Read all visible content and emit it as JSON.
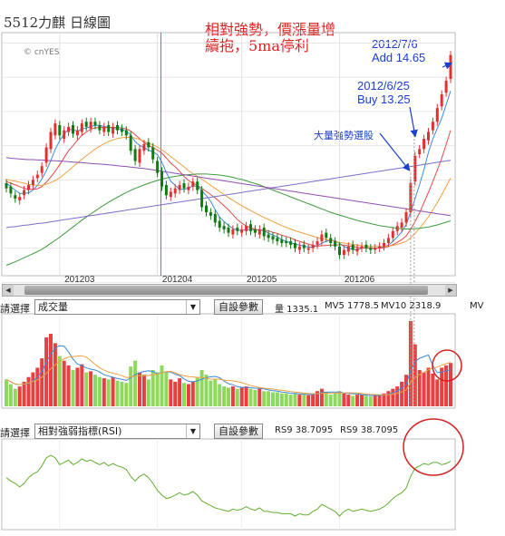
{
  "title": "5512力麒 日線圖",
  "copyright": "© cnYES",
  "annotation_red": [
    "相對強勢，價漲量增",
    "續抱，5ma停利"
  ],
  "annotation_buy": [
    "2012/6/25",
    "Buy 13.25"
  ],
  "annotation_add": [
    "2012/7/6",
    "Add 14.65"
  ],
  "annotation_volume": "大量強勢選股",
  "x_axis_labels": [
    "201203",
    "201204",
    "201205",
    "201206"
  ],
  "volume_panel": {
    "select_label": "請選擇",
    "select_value": "成交量",
    "button": "自設參數",
    "legend": [
      "量 1335.1",
      "MV5 1778.5",
      "MV10 2318.9",
      "MV"
    ]
  },
  "rsi_panel": {
    "select_label": "請選擇",
    "select_value": "相對強弱指標(RSI)",
    "button": "自設參數",
    "legend": [
      "RS9 38.7095",
      "RS9 38.7095"
    ]
  },
  "colors": {
    "up": "#e23030",
    "down": "#137a13",
    "ma_blue": "#3a8ad8",
    "ma_orange": "#f2a040",
    "ma_green": "#3c9c3c",
    "ma_purple": "#9050b0",
    "rsi": "#60b030",
    "vol_up": "#e84040",
    "vol_down": "#8ed860",
    "note_red": "#e02020",
    "note_blue": "#1b3fd0"
  },
  "chart_data": {
    "type": "candlestick",
    "x": [
      "2012-02-13",
      "2012-02-14",
      "2012-02-15",
      "2012-02-16",
      "2012-02-17",
      "2012-02-20",
      "2012-02-21",
      "2012-02-22",
      "2012-02-23",
      "2012-02-24",
      "2012-02-27",
      "2012-02-29",
      "2012-03-01",
      "2012-03-02",
      "2012-03-05",
      "2012-03-06",
      "2012-03-07",
      "2012-03-08",
      "2012-03-09",
      "2012-03-12",
      "2012-03-13",
      "2012-03-14",
      "2012-03-15",
      "2012-03-16",
      "2012-03-19",
      "2012-03-20",
      "2012-03-21",
      "2012-03-22",
      "2012-03-23",
      "2012-03-26",
      "2012-03-27",
      "2012-03-28",
      "2012-03-29",
      "2012-03-30",
      "2012-04-02",
      "2012-04-05",
      "2012-04-06",
      "2012-04-09",
      "2012-04-10",
      "2012-04-11",
      "2012-04-12",
      "2012-04-13",
      "2012-04-16",
      "2012-04-17",
      "2012-04-18",
      "2012-04-19",
      "2012-04-20",
      "2012-04-23",
      "2012-04-24",
      "2012-04-25",
      "2012-04-26",
      "2012-04-27",
      "2012-04-30",
      "2012-05-02",
      "2012-05-03",
      "2012-05-04",
      "2012-05-07",
      "2012-05-08",
      "2012-05-09",
      "2012-05-10",
      "2012-05-11",
      "2012-05-14",
      "2012-05-15",
      "2012-05-16",
      "2012-05-17",
      "2012-05-18",
      "2012-05-21",
      "2012-05-22",
      "2012-05-23",
      "2012-05-24",
      "2012-05-25",
      "2012-05-28",
      "2012-05-29",
      "2012-05-30",
      "2012-05-31",
      "2012-06-01",
      "2012-06-04",
      "2012-06-05",
      "2012-06-06",
      "2012-06-07",
      "2012-06-08",
      "2012-06-11",
      "2012-06-12",
      "2012-06-13",
      "2012-06-14",
      "2012-06-15",
      "2012-06-18",
      "2012-06-19",
      "2012-06-20",
      "2012-06-21",
      "2012-06-22",
      "2012-06-25",
      "2012-06-26",
      "2012-06-27",
      "2012-06-28",
      "2012-06-29",
      "2012-07-02",
      "2012-07-03",
      "2012-07-04",
      "2012-07-05",
      "2012-07-06"
    ],
    "close": [
      10.75,
      10.6,
      10.45,
      10.5,
      10.7,
      10.85,
      11.0,
      11.15,
      11.4,
      11.95,
      12.4,
      12.65,
      12.3,
      12.45,
      12.55,
      12.35,
      12.45,
      12.65,
      12.55,
      12.7,
      12.6,
      12.45,
      12.55,
      12.4,
      12.55,
      12.45,
      12.4,
      12.3,
      11.85,
      11.55,
      11.9,
      12.05,
      11.95,
      11.6,
      11.2,
      10.8,
      10.55,
      10.65,
      10.75,
      10.85,
      10.75,
      10.8,
      10.95,
      10.7,
      10.2,
      10.05,
      9.95,
      9.75,
      9.6,
      9.55,
      9.45,
      9.55,
      9.5,
      9.55,
      9.65,
      9.5,
      9.45,
      9.55,
      9.35,
      9.3,
      9.25,
      9.2,
      9.15,
      9.15,
      9.1,
      9.0,
      9.05,
      9.0,
      9.0,
      9.1,
      9.2,
      9.4,
      9.3,
      9.15,
      9.05,
      8.8,
      8.95,
      9.05,
      8.95,
      9.0,
      9.05,
      9.0,
      8.95,
      9.0,
      9.05,
      9.15,
      9.3,
      9.5,
      9.65,
      9.75,
      10.05,
      10.9,
      11.7,
      11.9,
      12.2,
      12.4,
      12.7,
      13.1,
      13.5,
      13.9,
      14.65
    ],
    "open": [
      10.9,
      10.8,
      10.55,
      10.4,
      10.55,
      10.7,
      10.85,
      11.05,
      11.2,
      11.5,
      11.9,
      12.3,
      12.6,
      12.2,
      12.4,
      12.6,
      12.3,
      12.4,
      12.7,
      12.5,
      12.7,
      12.6,
      12.4,
      12.6,
      12.35,
      12.6,
      12.5,
      12.45,
      12.3,
      11.9,
      11.5,
      11.85,
      12.1,
      11.95,
      11.55,
      11.25,
      10.85,
      10.5,
      10.6,
      10.7,
      10.9,
      10.7,
      10.8,
      10.95,
      10.7,
      10.25,
      10.05,
      10.0,
      9.8,
      9.65,
      9.6,
      9.4,
      9.6,
      9.45,
      9.5,
      9.7,
      9.55,
      9.4,
      9.6,
      9.4,
      9.35,
      9.3,
      9.25,
      9.2,
      9.2,
      9.15,
      8.95,
      9.1,
      8.95,
      9.0,
      9.1,
      9.2,
      9.45,
      9.3,
      9.2,
      9.05,
      8.8,
      8.9,
      9.1,
      8.9,
      9.0,
      9.1,
      9.0,
      8.95,
      9.0,
      9.05,
      9.15,
      9.3,
      9.5,
      9.6,
      9.75,
      10.05,
      10.95,
      11.75,
      11.9,
      12.15,
      12.45,
      12.7,
      13.15,
      13.55,
      13.95
    ],
    "series": [
      {
        "name": "MA5",
        "values": [
          10.9,
          10.8,
          10.7,
          10.6,
          10.6,
          10.62,
          10.7,
          10.84,
          11.02,
          11.27,
          11.56,
          11.89,
          12.14,
          12.35,
          12.47,
          12.47,
          12.42,
          12.49,
          12.51,
          12.56,
          12.59,
          12.59,
          12.56,
          12.54,
          12.51,
          12.48,
          12.47,
          12.43,
          12.31,
          12.12,
          12.01,
          11.94,
          11.87,
          11.82,
          11.74,
          11.52,
          11.22,
          10.96,
          10.84,
          10.72,
          10.72,
          10.76,
          10.82,
          10.81,
          10.68,
          10.54,
          10.37,
          10.13,
          9.91,
          9.78,
          9.67,
          9.57,
          9.53,
          9.52,
          9.54,
          9.55,
          9.53,
          9.54,
          9.51,
          9.44,
          9.38,
          9.33,
          9.25,
          9.2,
          9.16,
          9.12,
          9.09,
          9.06,
          9.03,
          9.03,
          9.07,
          9.15,
          9.2,
          9.23,
          9.22,
          9.14,
          9.05,
          9.0,
          8.96,
          8.95,
          9.0,
          9.01,
          8.99,
          9.0,
          9.01,
          9.04,
          9.09,
          9.2,
          9.33,
          9.47,
          9.69,
          10.05,
          10.45,
          10.85,
          11.3,
          11.8,
          12.2,
          12.5,
          12.8,
          13.2,
          13.6
        ]
      },
      {
        "name": "MA10",
        "values": [
          10.95,
          10.9,
          10.85,
          10.8,
          10.75,
          10.72,
          10.72,
          10.74,
          10.8,
          10.93,
          11.08,
          11.25,
          11.44,
          11.65,
          11.85,
          12.0,
          12.16,
          12.3,
          12.4,
          12.48,
          12.52,
          12.53,
          12.53,
          12.53,
          12.54,
          12.53,
          12.52,
          12.49,
          12.43,
          12.32,
          12.2,
          12.1,
          12.0,
          11.95,
          11.87,
          11.78,
          11.64,
          11.49,
          11.38,
          11.25,
          11.1,
          10.98,
          10.9,
          10.84,
          10.75,
          10.66,
          10.57,
          10.47,
          10.36,
          10.24,
          10.12,
          9.98,
          9.84,
          9.73,
          9.65,
          9.6,
          9.55,
          9.53,
          9.52,
          9.51,
          9.46,
          9.43,
          9.38,
          9.34,
          9.3,
          9.24,
          9.2,
          9.16,
          9.12,
          9.08,
          9.06,
          9.07,
          9.08,
          9.09,
          9.09,
          9.1,
          9.09,
          9.07,
          9.05,
          9.03,
          9.01,
          9.01,
          9.01,
          9.0,
          9.0,
          9.01,
          9.05,
          9.1,
          9.17,
          9.25,
          9.36,
          9.55,
          9.78,
          10.03,
          10.33,
          10.63,
          10.95,
          11.28,
          11.63,
          12.03,
          12.45
        ]
      },
      {
        "name": "MA20",
        "values": [
          11.0,
          10.98,
          10.96,
          10.93,
          10.9,
          10.87,
          10.85,
          10.84,
          10.84,
          10.87,
          10.92,
          10.98,
          11.06,
          11.16,
          11.27,
          11.38,
          11.49,
          11.6,
          11.7,
          11.8,
          11.9,
          11.98,
          12.06,
          12.12,
          12.17,
          12.21,
          12.23,
          12.24,
          12.24,
          12.22,
          12.18,
          12.13,
          12.07,
          12.02,
          11.96,
          11.88,
          11.78,
          11.68,
          11.58,
          11.48,
          11.38,
          11.27,
          11.18,
          11.1,
          11.02,
          10.93,
          10.84,
          10.75,
          10.66,
          10.57,
          10.48,
          10.4,
          10.32,
          10.24,
          10.17,
          10.1,
          10.03,
          9.96,
          9.9,
          9.84,
          9.78,
          9.72,
          9.66,
          9.61,
          9.56,
          9.51,
          9.47,
          9.43,
          9.39,
          9.35,
          9.31,
          9.28,
          9.25,
          9.23,
          9.2,
          9.17,
          9.15,
          9.13,
          9.11,
          9.09,
          9.07,
          9.06,
          9.05,
          9.05,
          9.05,
          9.05,
          9.06,
          9.08,
          9.11,
          9.15,
          9.2,
          9.3,
          9.43,
          9.58,
          9.74,
          9.92,
          10.12,
          10.33,
          10.56,
          10.8,
          11.05
        ]
      },
      {
        "name": "MA60",
        "values": [
          8.5,
          8.55,
          8.6,
          8.66,
          8.72,
          8.78,
          8.84,
          8.9,
          8.97,
          9.05,
          9.14,
          9.23,
          9.32,
          9.42,
          9.52,
          9.62,
          9.72,
          9.82,
          9.91,
          10.0,
          10.09,
          10.18,
          10.26,
          10.34,
          10.42,
          10.49,
          10.56,
          10.63,
          10.69,
          10.75,
          10.8,
          10.85,
          10.9,
          10.94,
          10.98,
          11.02,
          11.05,
          11.08,
          11.1,
          11.12,
          11.14,
          11.15,
          11.16,
          11.17,
          11.17,
          11.17,
          11.16,
          11.15,
          11.14,
          11.12,
          11.1,
          11.07,
          11.04,
          11.01,
          10.97,
          10.93,
          10.89,
          10.85,
          10.8,
          10.75,
          10.7,
          10.65,
          10.6,
          10.55,
          10.5,
          10.45,
          10.4,
          10.35,
          10.3,
          10.25,
          10.2,
          10.15,
          10.1,
          10.05,
          10.01,
          9.97,
          9.93,
          9.89,
          9.85,
          9.81,
          9.78,
          9.75,
          9.72,
          9.69,
          9.66,
          9.64,
          9.62,
          9.6,
          9.58,
          9.57,
          9.56,
          9.56,
          9.57,
          9.58,
          9.6,
          9.62,
          9.65,
          9.68,
          9.72,
          9.76,
          9.8
        ]
      },
      {
        "name": "MA120",
        "values": [
          9.6,
          9.62,
          9.63,
          9.65,
          9.67,
          9.68,
          9.7,
          9.72,
          9.73,
          9.75,
          9.77,
          9.79,
          9.81,
          9.83,
          9.85,
          9.87,
          9.89,
          9.91,
          9.93,
          9.95,
          9.97,
          9.99,
          10.01,
          10.03,
          10.05,
          10.07,
          10.09,
          10.11,
          10.13,
          10.15,
          10.17,
          10.19,
          10.21,
          10.23,
          10.25,
          10.27,
          10.29,
          10.31,
          10.33,
          10.35,
          10.37,
          10.39,
          10.41,
          10.43,
          10.45,
          10.47,
          10.49,
          10.51,
          10.53,
          10.55,
          10.57,
          10.59,
          10.61,
          10.63,
          10.65,
          10.67,
          10.69,
          10.71,
          10.73,
          10.75,
          10.77,
          10.79,
          10.81,
          10.83,
          10.85,
          10.87,
          10.89,
          10.91,
          10.93,
          10.95,
          10.97,
          10.99,
          11.01,
          11.03,
          11.05,
          11.07,
          11.09,
          11.11,
          11.13,
          11.15,
          11.17,
          11.19,
          11.21,
          11.23,
          11.25,
          11.27,
          11.29,
          11.31,
          11.33,
          11.35,
          11.37,
          11.39,
          11.41,
          11.43,
          11.45,
          11.47,
          11.49,
          11.51,
          11.53,
          11.55,
          11.57
        ]
      },
      {
        "name": "MA240",
        "values": [
          11.65,
          11.63,
          11.62,
          11.61,
          11.6,
          11.59,
          11.59,
          11.58,
          11.58,
          11.57,
          11.56,
          11.56,
          11.55,
          11.54,
          11.53,
          11.52,
          11.51,
          11.5,
          11.49,
          11.48,
          11.47,
          11.46,
          11.45,
          11.44,
          11.43,
          11.41,
          11.4,
          11.39,
          11.37,
          11.36,
          11.34,
          11.33,
          11.31,
          11.29,
          11.27,
          11.25,
          11.23,
          11.21,
          11.19,
          11.17,
          11.15,
          11.13,
          11.11,
          11.09,
          11.07,
          11.05,
          11.03,
          11.01,
          10.99,
          10.97,
          10.95,
          10.93,
          10.91,
          10.89,
          10.87,
          10.85,
          10.83,
          10.81,
          10.79,
          10.77,
          10.75,
          10.73,
          10.71,
          10.69,
          10.67,
          10.65,
          10.63,
          10.61,
          10.59,
          10.57,
          10.55,
          10.53,
          10.51,
          10.49,
          10.47,
          10.45,
          10.43,
          10.41,
          10.39,
          10.37,
          10.35,
          10.33,
          10.31,
          10.29,
          10.27,
          10.25,
          10.23,
          10.21,
          10.19,
          10.17,
          10.15,
          10.13,
          10.11,
          10.09,
          10.07,
          10.05,
          10.03,
          10.01,
          9.99,
          9.97,
          9.95
        ]
      }
    ],
    "volume": [
      2300,
      1900,
      1500,
      1700,
      2100,
      2500,
      2900,
      3300,
      4100,
      5900,
      6200,
      5400,
      4300,
      3900,
      3500,
      3100,
      3300,
      3600,
      2900,
      3000,
      2700,
      2500,
      2400,
      2300,
      2500,
      2200,
      2100,
      2000,
      3400,
      3900,
      2900,
      2700,
      2300,
      3100,
      2900,
      3500,
      2900,
      2300,
      2100,
      2400,
      2000,
      1900,
      2100,
      2500,
      3100,
      2700,
      2200,
      2300,
      1900,
      1700,
      1600,
      1700,
      1500,
      1600,
      1700,
      1500,
      1400,
      1500,
      1300,
      1300,
      1200,
      1200,
      1100,
      1100,
      1000,
      1100,
      1000,
      1000,
      950,
      1100,
      1300,
      1500,
      1200,
      1000,
      1100,
      1300,
      1100,
      1000,
      900,
      1000,
      1000,
      900,
      850,
      900,
      1000,
      1100,
      1300,
      1500,
      1700,
      2100,
      2700,
      7300,
      5300,
      3100,
      2900,
      3300,
      2800,
      2300,
      3300,
      3500,
      3700
    ],
    "rsi": [
      55,
      52,
      50,
      47,
      50,
      55,
      58,
      60,
      65,
      72,
      74,
      72,
      66,
      68,
      70,
      66,
      68,
      71,
      69,
      70,
      68,
      66,
      68,
      65,
      67,
      65,
      64,
      62,
      56,
      52,
      56,
      58,
      55,
      50,
      44,
      40,
      37,
      38,
      40,
      42,
      40,
      41,
      43,
      40,
      35,
      33,
      31,
      29,
      28,
      27,
      26,
      28,
      27,
      28,
      30,
      28,
      27,
      29,
      26,
      26,
      25,
      25,
      24,
      24,
      24,
      22,
      24,
      23,
      23,
      26,
      28,
      32,
      30,
      28,
      26,
      22,
      26,
      28,
      26,
      27,
      28,
      27,
      26,
      27,
      28,
      30,
      33,
      37,
      40,
      42,
      46,
      56,
      63,
      65,
      67,
      66,
      68,
      68,
      66,
      67,
      69
    ]
  }
}
